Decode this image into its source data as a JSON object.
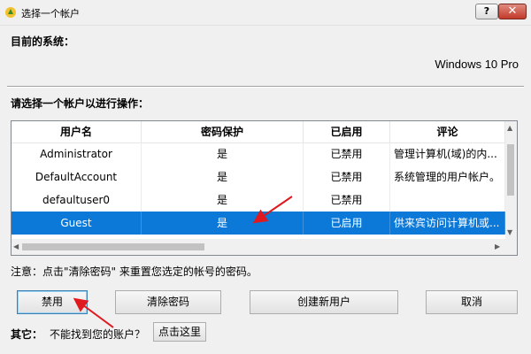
{
  "window": {
    "title": "选择一个帐户",
    "help_label": "?",
    "close_label": "✕"
  },
  "system": {
    "label": "目前的系统：",
    "value": "Windows 10 Pro"
  },
  "prompt": "请选择一个帐户以进行操作：",
  "table": {
    "columns": [
      "用户名",
      "密码保护",
      "已启用",
      "评论"
    ],
    "rows": [
      [
        "Administrator",
        "是",
        "已禁用",
        "管理计算机(域)的内..."
      ],
      [
        "DefaultAccount",
        "是",
        "已禁用",
        "系统管理的用户帐户。"
      ],
      [
        "defaultuser0",
        "是",
        "已禁用",
        ""
      ],
      [
        "Guest",
        "是",
        "已启用",
        "供来宾访问计算机或..."
      ]
    ],
    "selected_row": 3
  },
  "note": "注意：点击\"清除密码\" 来重置您选定的帐号的密码。",
  "buttons": {
    "disable": "禁用",
    "clear_password": "清除密码",
    "create_user": "创建新用户",
    "cancel": "取消"
  },
  "other": {
    "label": "其它：",
    "question": "不能找到您的账户？",
    "link": "点击这里"
  },
  "colors": {
    "selection": "#0c79d8",
    "annotation": "#e0191f"
  }
}
